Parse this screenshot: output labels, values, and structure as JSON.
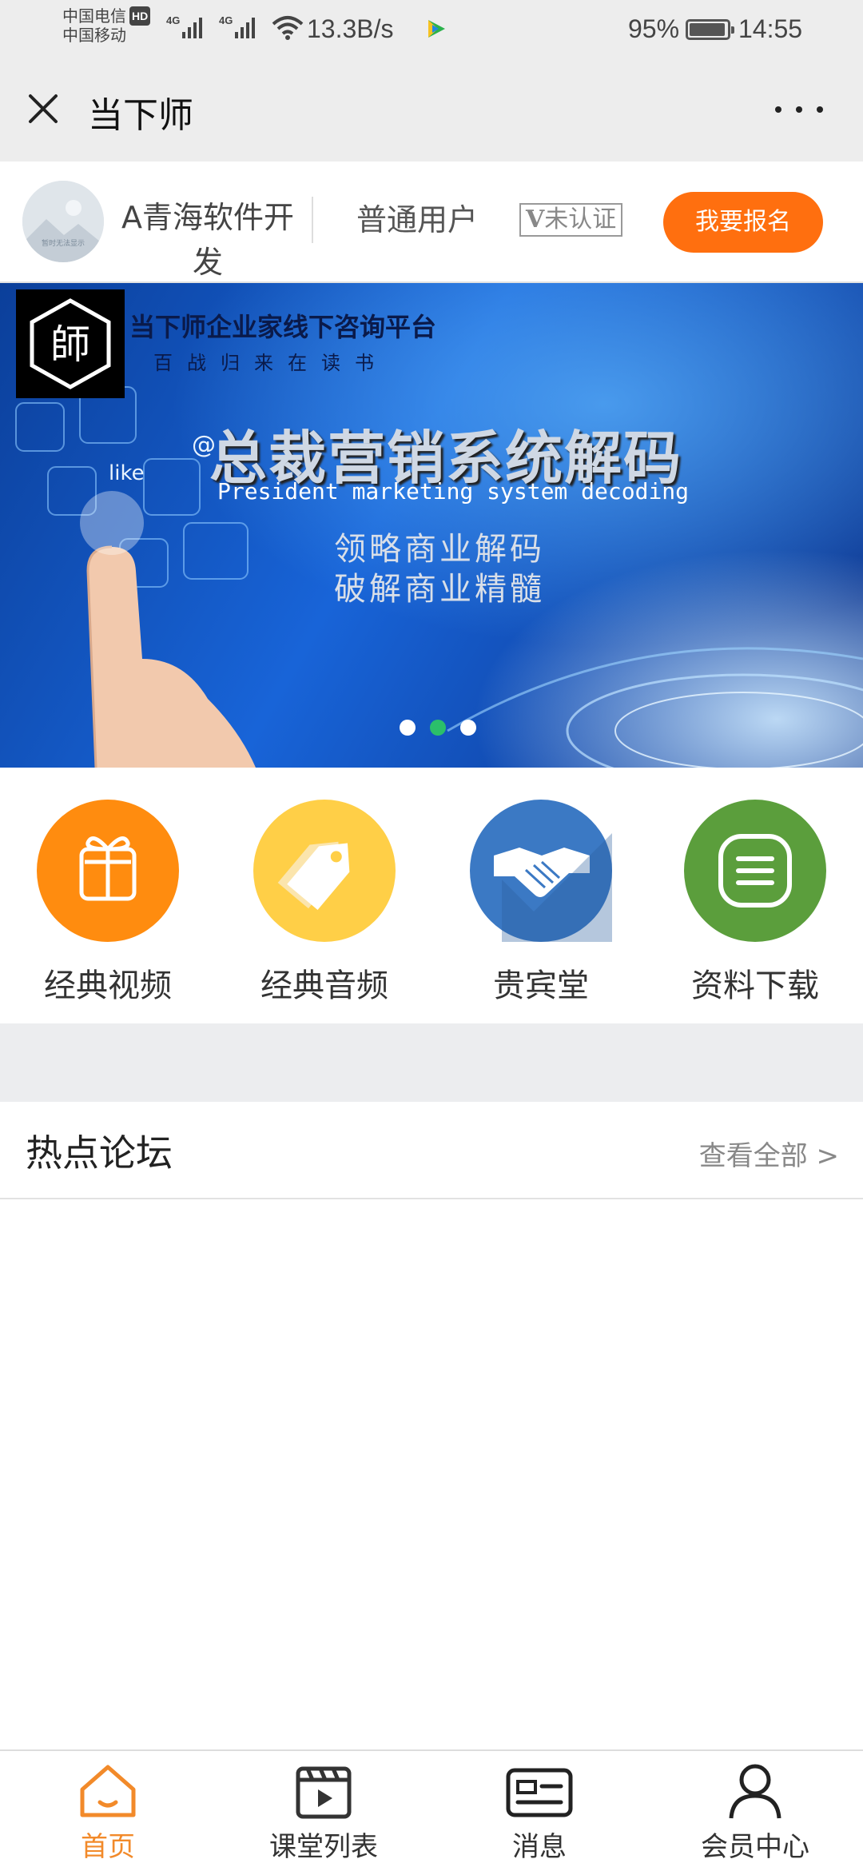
{
  "status_bar": {
    "carrier1": "中国电信",
    "carrier_badge": "HD",
    "carrier2": "中国移动",
    "signal1_label": "4G",
    "signal2_label": "4G",
    "net_speed": "13.3B/s",
    "battery_percent": "95%",
    "battery_level": 0.95,
    "time": "14:55"
  },
  "title_bar": {
    "title": "当下师"
  },
  "user_bar": {
    "avatar_caption": "暂时无法显示",
    "company_name": "A青海软件开发",
    "role": "普通用户",
    "cert_prefix": "V",
    "cert_status": "未认证",
    "signup_label": "我要报名"
  },
  "banner": {
    "logo_char": "師",
    "brand": "当下师企业家线下咨询平台",
    "slogan": "百战归来在读书",
    "headline": "总裁营销系统解码",
    "headline_en": "President marketing system decoding",
    "sub1": "领略商业解码",
    "sub2": "破解商业精髓",
    "like_text": "like",
    "at_text": "@",
    "active_dot": 1
  },
  "categories": [
    {
      "label": "经典视频",
      "icon": "gift-icon",
      "color": "#ff8c0f"
    },
    {
      "label": "经典音频",
      "icon": "tag-icon",
      "color": "#ffcf47"
    },
    {
      "label": "贵宾堂",
      "icon": "handshake-icon",
      "color": "#3b79c4"
    },
    {
      "label": "资料下载",
      "icon": "list-icon",
      "color": "#5b9e3c"
    }
  ],
  "forum": {
    "title": "热点论坛",
    "view_all": "查看全部 >"
  },
  "tab_bar": {
    "items": [
      {
        "label": "首页",
        "icon": "home-icon",
        "active": true
      },
      {
        "label": "课堂列表",
        "icon": "video-icon",
        "active": false
      },
      {
        "label": "消息",
        "icon": "message-card-icon",
        "active": false
      },
      {
        "label": "会员中心",
        "icon": "user-icon",
        "active": false
      }
    ],
    "active_color": "#f28a2a"
  }
}
